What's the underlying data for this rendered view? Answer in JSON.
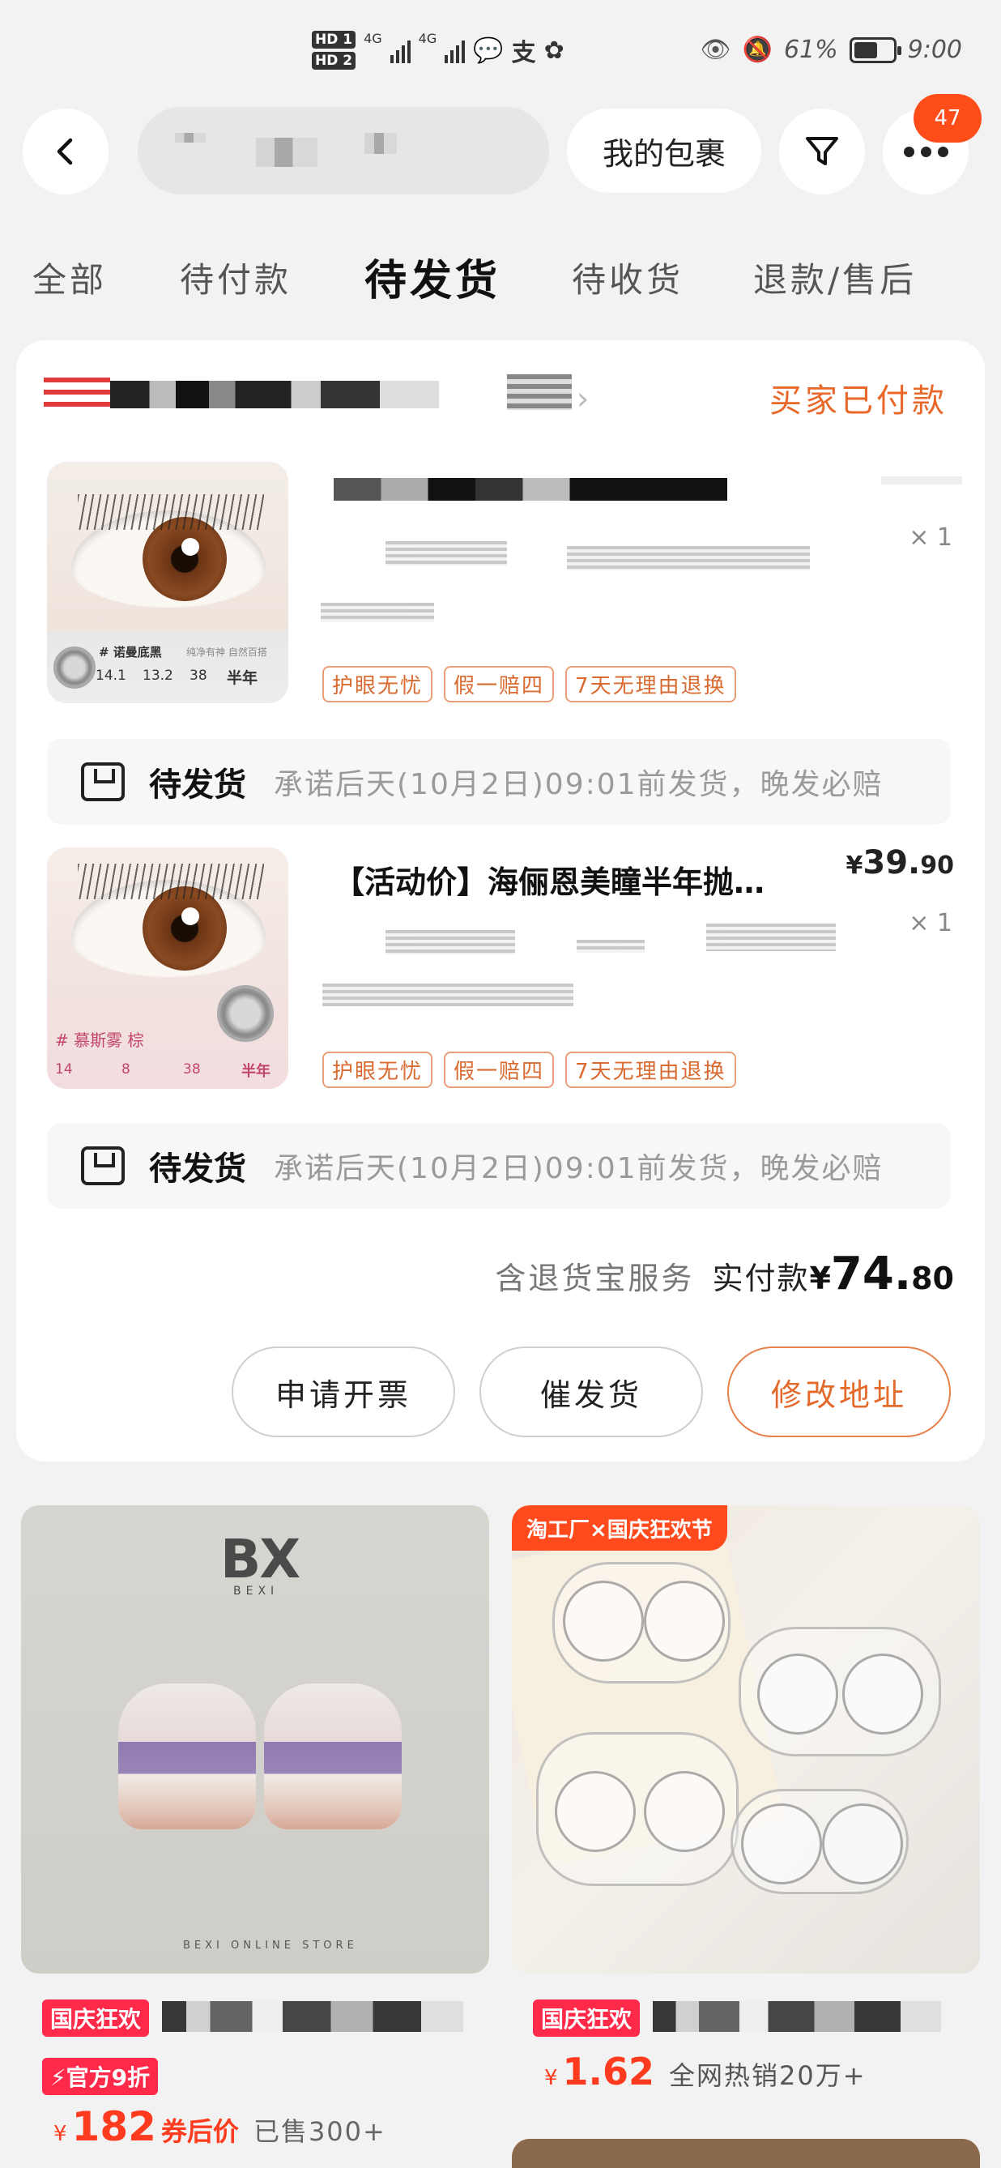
{
  "status_bar": {
    "hd1": "HD 1",
    "hd2": "HD 2",
    "network1": "4G",
    "network2": "4G",
    "battery": "61%",
    "battery_level": 0.61,
    "time": "9:00"
  },
  "top_bar": {
    "my_packages_label": "我的包裹",
    "notification_count": "47"
  },
  "tabs": [
    {
      "label": "全部",
      "active": false
    },
    {
      "label": "待付款",
      "active": false
    },
    {
      "label": "待发货",
      "active": true
    },
    {
      "label": "待收货",
      "active": false
    },
    {
      "label": "退款/售后",
      "active": false
    }
  ],
  "order": {
    "status": "买家已付款",
    "items": [
      {
        "thumb_label": "# 诺曼底黑",
        "thumb_sub": "纯净有神 自然百搭",
        "thumb_specs": [
          "14.1",
          "13.2",
          "38",
          "半年"
        ],
        "quantity": "× 1",
        "tags": [
          "护眼无忧",
          "假一赔四",
          "7天无理由退换"
        ],
        "shipping_status": "待发货",
        "shipping_promise": "承诺后天(10月2日)09:01前发货，晚发必赔"
      },
      {
        "title": "【活动价】海俪恩美瞳半年抛…",
        "price_currency": "¥",
        "price_int": "39.",
        "price_dec": "90",
        "thumb_label": "# 慕斯雾 棕",
        "thumb_specs": [
          "14",
          "8",
          "38",
          "半年"
        ],
        "quantity": "× 1",
        "tags": [
          "护眼无忧",
          "假一赔四",
          "7天无理由退换"
        ],
        "shipping_status": "待发货",
        "shipping_promise": "承诺后天(10月2日)09:01前发货，晚发必赔"
      }
    ],
    "service_note": "含退货宝服务",
    "total_label": "实付款",
    "total_currency": "¥",
    "total_int": "74.",
    "total_dec": "80",
    "actions": [
      "申请开票",
      "催发货",
      "修改地址"
    ]
  },
  "recommendations": [
    {
      "brand": "BX",
      "brand_sub": "BEXI",
      "store_text": "BEXI ONLINE STORE",
      "tag": "国庆狂欢",
      "discount": "⚡官方9折",
      "price_currency": "¥",
      "price": "182",
      "price_note": "券后价",
      "sold": "已售300+"
    },
    {
      "ribbon": "淘工厂×国庆狂欢节",
      "tag": "国庆狂欢",
      "price_currency": "¥",
      "price": "1.62",
      "sold": "全网热销20万+"
    }
  ],
  "colors": {
    "accent_orange": "#e8682a",
    "promo_red": "#ff2a4a",
    "price_red": "#ff3b1f",
    "badge_red": "#ff4d1a"
  },
  "icons": [
    "back-arrow-icon",
    "filter-icon",
    "more-dots-icon",
    "shipping-box-icon",
    "chevron-right-icon",
    "eye-icon",
    "mute-bell-icon",
    "battery-icon",
    "chat-icon",
    "alipay-icon",
    "wechat-icon"
  ]
}
